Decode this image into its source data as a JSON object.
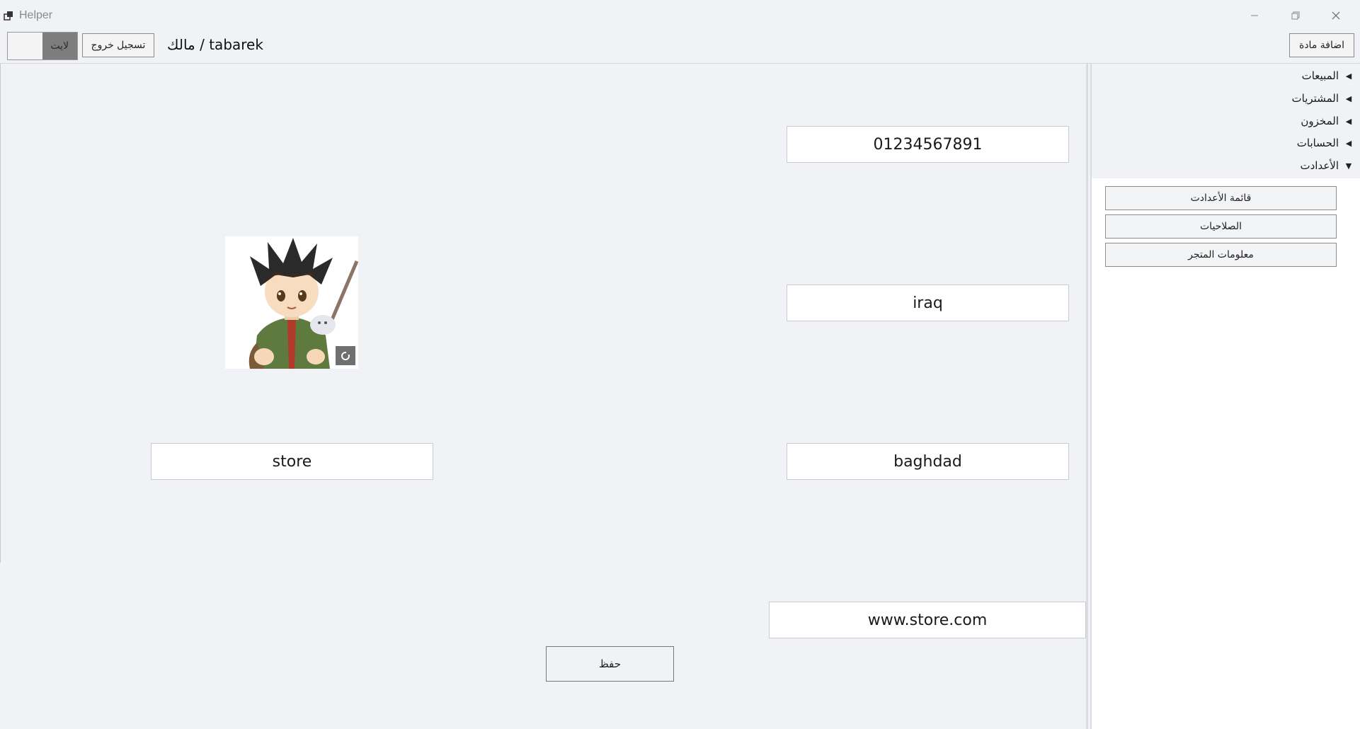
{
  "window": {
    "title": "Helper"
  },
  "toolbar": {
    "theme_toggle_label": "لايت",
    "logout_label": "تسجيل خروج",
    "user_label": "مالك / tabarek",
    "add_item_label": "اضافة مادة"
  },
  "store_form": {
    "phone_value": "01234567891",
    "country_value": "iraq",
    "city_value": "baghdad",
    "store_name_value": "store",
    "website_value": "www.store.com",
    "save_label": "حفظ"
  },
  "sidebar": {
    "items": [
      {
        "label": "المبيعات",
        "expanded": false
      },
      {
        "label": "المشتريات",
        "expanded": false
      },
      {
        "label": "المخزون",
        "expanded": false
      },
      {
        "label": "الحسابات",
        "expanded": false
      },
      {
        "label": "الأعدادت",
        "expanded": true
      }
    ],
    "settings_sub_items": [
      {
        "label": "قائمة الأعدادت"
      },
      {
        "label": "الصلاحيات"
      },
      {
        "label": "معلومات المتجر"
      }
    ]
  },
  "icons": {
    "app": "app-icon",
    "minimize": "minimize-icon",
    "maximize": "restore-icon",
    "close": "close-icon",
    "collapsed_arrow": "triangle-left-icon",
    "expanded_arrow": "triangle-down-icon",
    "camera": "camera-icon"
  },
  "colors": {
    "background": "#f0f2f5",
    "field_background": "#ffffff",
    "toggle_knob": "#7d7d7d"
  }
}
